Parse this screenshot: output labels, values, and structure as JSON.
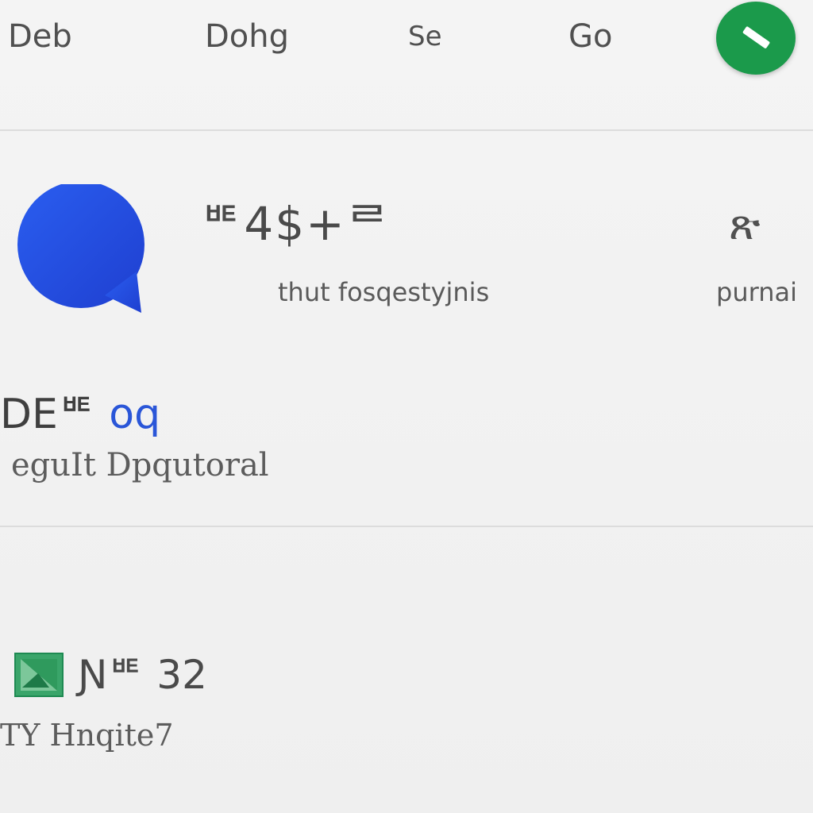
{
  "nav": {
    "items": [
      "Deb",
      "Dohg",
      "Se",
      "Go"
    ]
  },
  "fab": {
    "icon": "pencil-icon",
    "color": "#1b9a4b"
  },
  "chat_row": {
    "icon": "chat-bubble-icon",
    "icon_color": "#2a56d8",
    "title": "ᄩ4$+ᄅ",
    "subtitle": "thut fosqestyjnis",
    "side_glyph": "ጽ",
    "side_text": "purnai"
  },
  "section": {
    "title": "DEᄩ",
    "title_accent": "oq",
    "subtitle": "eguIt Dpqutoral"
  },
  "bottom_row": {
    "icon": "image-icon",
    "icon_color": "#1e9a57",
    "title": "Ɲᄩ 32",
    "subtitle": "TY Hnqite7"
  }
}
